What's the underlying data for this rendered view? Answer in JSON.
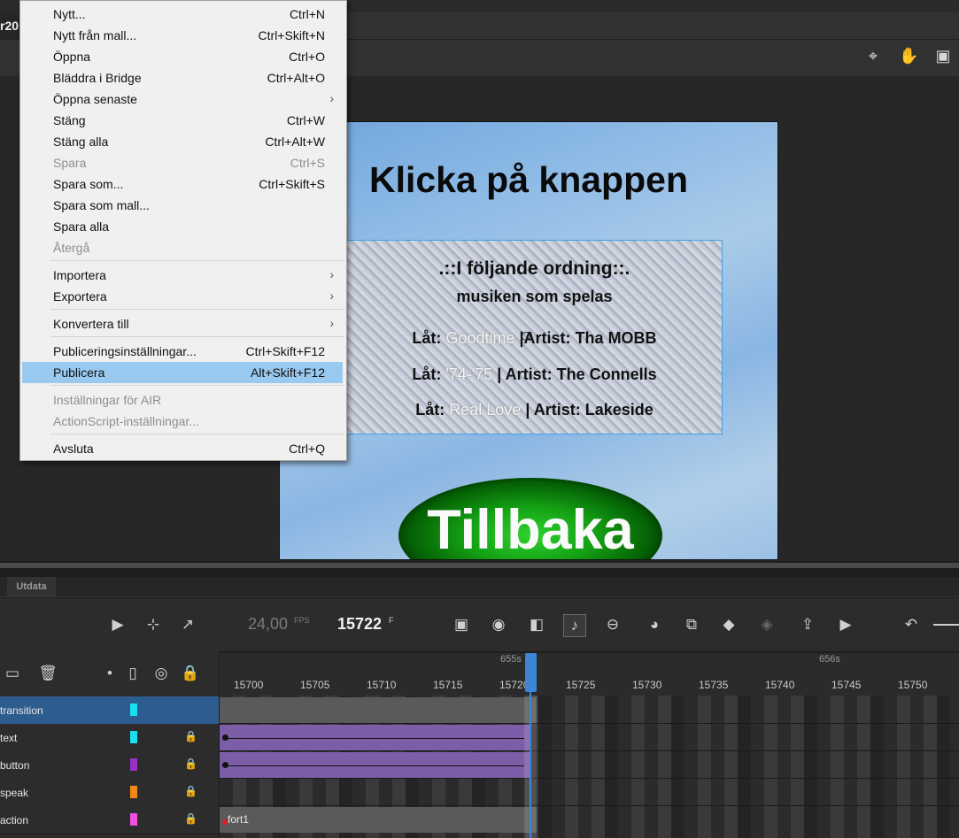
{
  "app": {
    "doc_tab": "r20"
  },
  "file_menu": {
    "items": [
      {
        "label": "Nytt...",
        "shortcut": "Ctrl+N"
      },
      {
        "label": "Nytt från mall...",
        "shortcut": "Ctrl+Skift+N"
      },
      {
        "label": "Öppna",
        "shortcut": "Ctrl+O"
      },
      {
        "label": "Bläddra i Bridge",
        "shortcut": "Ctrl+Alt+O"
      },
      {
        "label": "Öppna senaste",
        "shortcut": ""
      },
      {
        "label": "Stäng",
        "shortcut": "Ctrl+W"
      },
      {
        "label": "Stäng alla",
        "shortcut": "Ctrl+Alt+W"
      },
      {
        "label": "Spara",
        "shortcut": "Ctrl+S"
      },
      {
        "label": "Spara som...",
        "shortcut": "Ctrl+Skift+S"
      },
      {
        "label": "Spara som mall...",
        "shortcut": ""
      },
      {
        "label": "Spara alla",
        "shortcut": ""
      },
      {
        "label": "Återgå",
        "shortcut": ""
      },
      {
        "label": "Importera",
        "shortcut": ""
      },
      {
        "label": "Exportera",
        "shortcut": ""
      },
      {
        "label": "Konvertera till",
        "shortcut": ""
      },
      {
        "label": "Publiceringsinställningar...",
        "shortcut": "Ctrl+Skift+F12"
      },
      {
        "label": "Publicera",
        "shortcut": "Alt+Skift+F12"
      },
      {
        "label": "Inställningar för AIR",
        "shortcut": ""
      },
      {
        "label": "ActionScript-inställningar...",
        "shortcut": ""
      },
      {
        "label": "Avsluta",
        "shortcut": "Ctrl+Q"
      }
    ],
    "submenu_arrow": "›"
  },
  "stage": {
    "title": "Klicka på knappen",
    "info_heading": ".::I följande ordning::.",
    "info_sub": "musiken som spelas",
    "songs": [
      {
        "lat_label": "Låt:",
        "song": "Goodtime",
        "sep": "|",
        "artist_label": "Artist:",
        "artist": "Tha MOBB"
      },
      {
        "lat_label": "Låt:",
        "song": "'74-'75",
        "sep": "|",
        "artist_label": "Artist:",
        "artist": "The Connells"
      },
      {
        "lat_label": "Låt:",
        "song": "Real Love",
        "sep": "|",
        "artist_label": "Artist:",
        "artist": "Lakeside"
      }
    ],
    "back_button": "Tillbaka"
  },
  "output_tab": "Utdata",
  "timeline": {
    "fps": "24,00",
    "fps_unit": "FPS",
    "current_frame": "15722",
    "frame_unit": "F",
    "time_labels": [
      "655s",
      "656s"
    ],
    "frame_ticks": [
      "15700",
      "15705",
      "15710",
      "15715",
      "15720",
      "15725",
      "15730",
      "15735",
      "15740",
      "15745",
      "15750"
    ],
    "layers": [
      {
        "name": "transition",
        "color": "#19e0f0",
        "selected": true,
        "locked": false
      },
      {
        "name": "text",
        "color": "#19e0f0",
        "selected": false,
        "locked": true
      },
      {
        "name": "button",
        "color": "#9b30c8",
        "selected": false,
        "locked": true
      },
      {
        "name": "speak",
        "color": "#f08a19",
        "selected": false,
        "locked": true
      },
      {
        "name": "action",
        "color": "#f050e0",
        "selected": false,
        "locked": true
      }
    ],
    "frame_label": "fort1"
  }
}
